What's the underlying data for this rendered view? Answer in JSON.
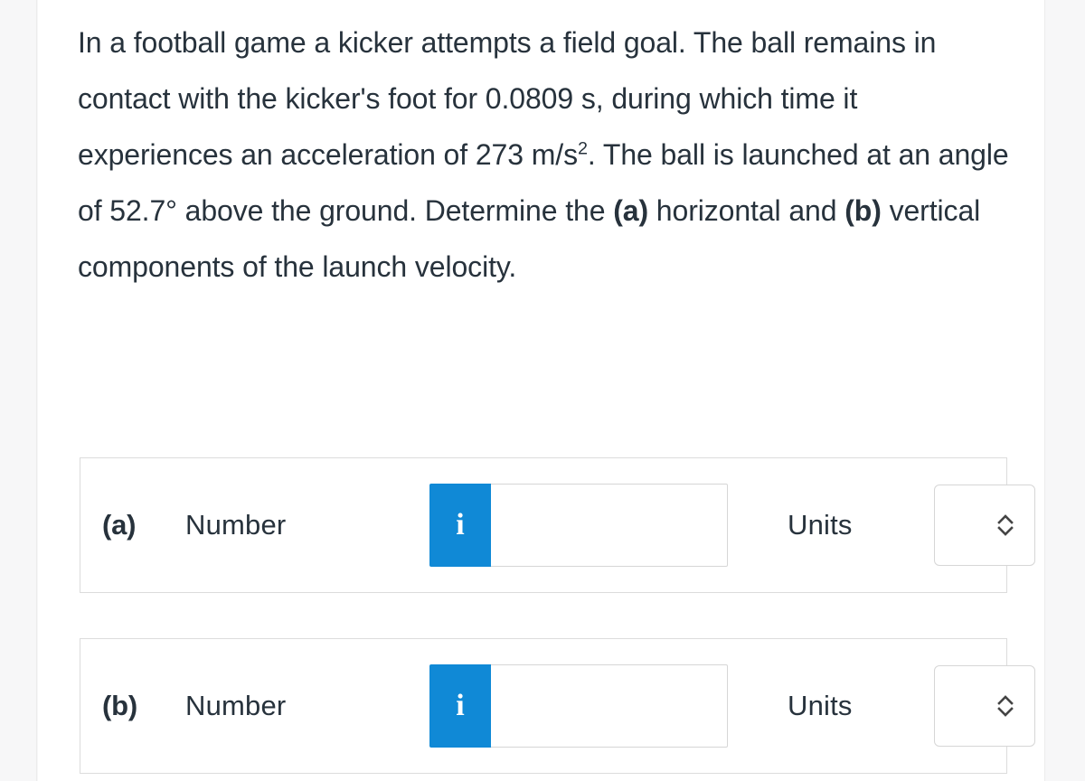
{
  "problem": {
    "text_segments": [
      {
        "text": "In a football game a kicker attempts a field goal. The ball remains in contact with the kicker's foot for 0.0809 s, during which time it experiences an acceleration of 273 m/s"
      },
      {
        "text": "2",
        "style": "superscript"
      },
      {
        "text": ". The ball is launched at an angle of 52.7° above the ground. Determine the "
      },
      {
        "text": "(a)",
        "style": "bold"
      },
      {
        "text": " horizontal and "
      },
      {
        "text": "(b)",
        "style": "bold"
      },
      {
        "text": " vertical components of the launch velocity."
      }
    ],
    "plain_text": "In a football game a kicker attempts a field goal. The ball remains in contact with the kicker's foot for 0.0809 s, during which time it experiences an acceleration of 273 m/s2. The ball is launched at an angle of 52.7° above the ground. Determine the (a) horizontal and (b) vertical components of the launch velocity.",
    "values": {
      "contact_time": "0.0809 s",
      "acceleration": "273 m/s²",
      "launch_angle": "52.7°"
    }
  },
  "answers": [
    {
      "part": "(a)",
      "number_label": "Number",
      "info_icon": "info-icon",
      "info_glyph": "i",
      "number_value": "",
      "number_placeholder": "",
      "units_label": "Units",
      "units_value": "",
      "units_icon": "chevron-up-down-icon",
      "units_options": []
    },
    {
      "part": "(b)",
      "number_label": "Number",
      "info_icon": "info-icon",
      "info_glyph": "i",
      "number_value": "",
      "number_placeholder": "",
      "units_label": "Units",
      "units_value": "",
      "units_icon": "chevron-up-down-icon",
      "units_options": []
    }
  ],
  "colors": {
    "text": "#27323c",
    "info_badge_blue": "#1089d6",
    "border_gray": "#dcdcdc",
    "input_border": "#d6d6d6",
    "page_background": "#ffffff",
    "gutter_background": "#f7f7f8",
    "chevron": "#444444"
  }
}
